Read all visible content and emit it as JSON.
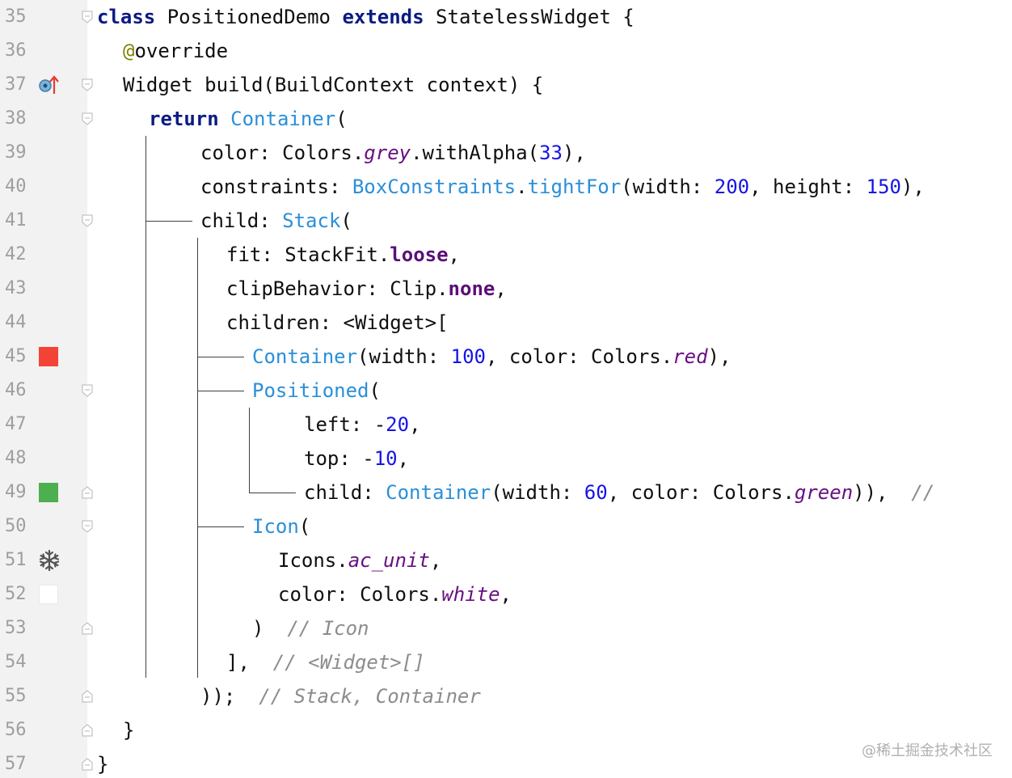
{
  "editor": {
    "line_numbers": [
      "35",
      "36",
      "37",
      "38",
      "39",
      "40",
      "41",
      "42",
      "43",
      "44",
      "45",
      "46",
      "47",
      "48",
      "49",
      "50",
      "51",
      "52",
      "53",
      "54",
      "55",
      "56",
      "57"
    ],
    "lines": [
      {
        "n": "35",
        "tokens": [
          {
            "t": "class",
            "c": "kw"
          },
          {
            "t": " PositionedDemo "
          },
          {
            "t": "extends",
            "c": "kw"
          },
          {
            "t": " StatelessWidget {"
          }
        ]
      },
      {
        "n": "36",
        "tokens": [
          {
            "t": "@",
            "c": "ann"
          },
          {
            "t": "override"
          }
        ]
      },
      {
        "n": "37",
        "tokens": [
          {
            "t": "Widget build(BuildContext context) {"
          }
        ]
      },
      {
        "n": "38",
        "tokens": [
          {
            "t": "return",
            "c": "kw"
          },
          {
            "t": " "
          },
          {
            "t": "Container",
            "c": "cls"
          },
          {
            "t": "("
          }
        ]
      },
      {
        "n": "39",
        "tokens": [
          {
            "t": "color: Colors."
          },
          {
            "t": "grey",
            "c": "prop"
          },
          {
            "t": ".withAlpha("
          },
          {
            "t": "33",
            "c": "num"
          },
          {
            "t": "),"
          }
        ]
      },
      {
        "n": "40",
        "tokens": [
          {
            "t": "constraints: "
          },
          {
            "t": "BoxConstraints",
            "c": "cls"
          },
          {
            "t": "."
          },
          {
            "t": "tightFor",
            "c": "cls"
          },
          {
            "t": "(width: "
          },
          {
            "t": "200",
            "c": "num"
          },
          {
            "t": ", height: "
          },
          {
            "t": "150",
            "c": "num"
          },
          {
            "t": "),"
          }
        ]
      },
      {
        "n": "41",
        "tokens": [
          {
            "t": "child: "
          },
          {
            "t": "Stack",
            "c": "cls"
          },
          {
            "t": "("
          }
        ]
      },
      {
        "n": "42",
        "tokens": [
          {
            "t": "fit: StackFit."
          },
          {
            "t": "loose",
            "c": "propb"
          },
          {
            "t": ","
          }
        ]
      },
      {
        "n": "43",
        "tokens": [
          {
            "t": "clipBehavior: Clip."
          },
          {
            "t": "none",
            "c": "propb"
          },
          {
            "t": ","
          }
        ]
      },
      {
        "n": "44",
        "tokens": [
          {
            "t": "children: <Widget>["
          }
        ]
      },
      {
        "n": "45",
        "tokens": [
          {
            "t": "Container",
            "c": "cls"
          },
          {
            "t": "(width: "
          },
          {
            "t": "100",
            "c": "num"
          },
          {
            "t": ", color: Colors."
          },
          {
            "t": "red",
            "c": "prop"
          },
          {
            "t": "),"
          }
        ]
      },
      {
        "n": "46",
        "tokens": [
          {
            "t": "Positioned",
            "c": "cls"
          },
          {
            "t": "("
          }
        ]
      },
      {
        "n": "47",
        "tokens": [
          {
            "t": "left: -"
          },
          {
            "t": "20",
            "c": "num"
          },
          {
            "t": ","
          }
        ]
      },
      {
        "n": "48",
        "tokens": [
          {
            "t": "top: -"
          },
          {
            "t": "10",
            "c": "num"
          },
          {
            "t": ","
          }
        ]
      },
      {
        "n": "49",
        "tokens": [
          {
            "t": "child: "
          },
          {
            "t": "Container",
            "c": "cls"
          },
          {
            "t": "(width: "
          },
          {
            "t": "60",
            "c": "num"
          },
          {
            "t": ", color: Colors."
          },
          {
            "t": "green",
            "c": "prop"
          },
          {
            "t": ")),  "
          },
          {
            "t": "//",
            "c": "cmt"
          }
        ]
      },
      {
        "n": "50",
        "tokens": [
          {
            "t": "Icon",
            "c": "cls"
          },
          {
            "t": "("
          }
        ]
      },
      {
        "n": "51",
        "tokens": [
          {
            "t": "Icons."
          },
          {
            "t": "ac_unit",
            "c": "prop"
          },
          {
            "t": ","
          }
        ]
      },
      {
        "n": "52",
        "tokens": [
          {
            "t": "color: Colors."
          },
          {
            "t": "white",
            "c": "prop"
          },
          {
            "t": ","
          }
        ]
      },
      {
        "n": "53",
        "tokens": [
          {
            "t": ")  "
          },
          {
            "t": "// Icon",
            "c": "cmt"
          }
        ]
      },
      {
        "n": "54",
        "tokens": [
          {
            "t": "],  "
          },
          {
            "t": "// <Widget>[]",
            "c": "cmt"
          }
        ]
      },
      {
        "n": "55",
        "tokens": [
          {
            "t": "));  "
          },
          {
            "t": "// Stack, Container",
            "c": "cmt"
          }
        ]
      },
      {
        "n": "56",
        "tokens": [
          {
            "t": "}"
          }
        ]
      },
      {
        "n": "57",
        "tokens": [
          {
            "t": "}"
          }
        ]
      }
    ]
  },
  "gutter_icons": {
    "line_37": "override-method-icon",
    "line_45": {
      "name": "color-swatch-red",
      "color": "#f44336"
    },
    "line_49": {
      "name": "color-swatch-green",
      "color": "#4caf50"
    },
    "line_51": "ac-unit-snowflake-icon",
    "line_52": {
      "name": "color-swatch-white",
      "color": "#ffffff"
    }
  },
  "watermark": "@稀土掘金技术社区",
  "colors": {
    "keyword": "#0b1b82",
    "class_ref": "#2a8fd8",
    "number": "#1414e6",
    "static_prop": "#6a0f82",
    "comment": "#8c8c8c",
    "annotation": "#808000",
    "gutter_bg": "#f2f2f2"
  }
}
